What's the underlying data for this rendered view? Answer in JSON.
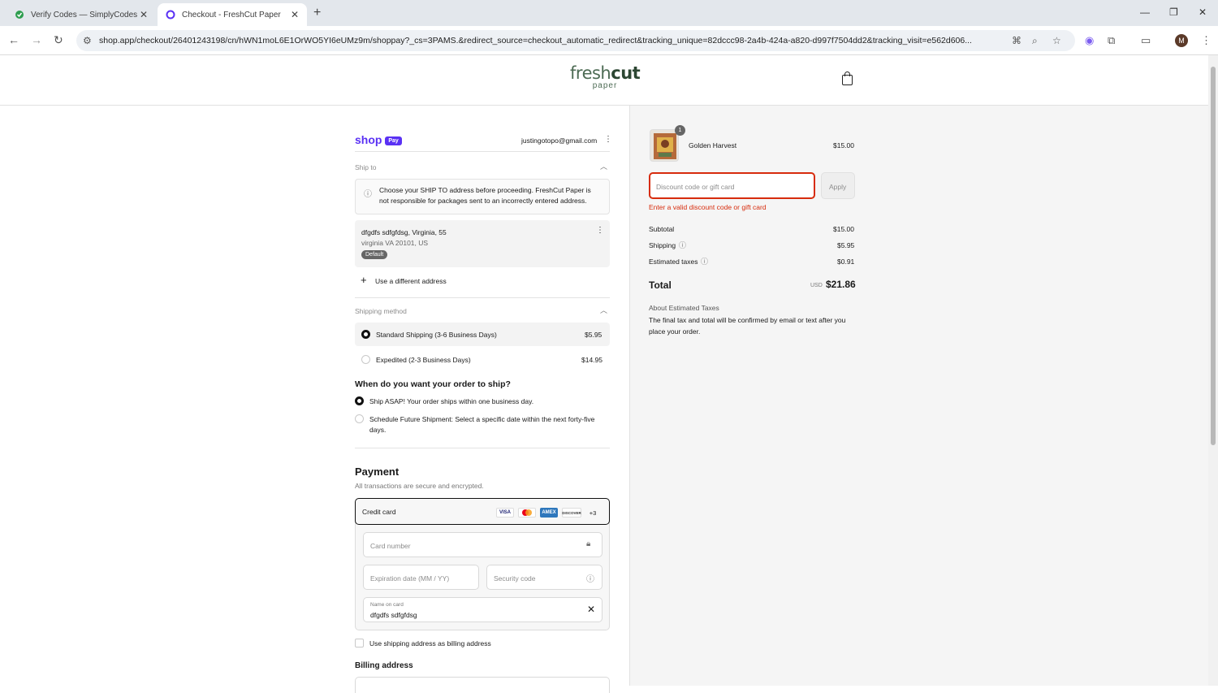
{
  "browser": {
    "tabs": [
      {
        "title": "Verify Codes — SimplyCodes"
      },
      {
        "title": "Checkout - FreshCut Paper"
      }
    ],
    "url": "shop.app/checkout/26401243198/cn/hWN1moL6E1OrWO5YI6eUMz9m/shoppay?_cs=3PAMS.&redirect_source=checkout_automatic_redirect&tracking_unique=82dccc98-2a4b-424a-a820-d997f7504dd2&tracking_visit=e562d606...",
    "profile_initial": "M"
  },
  "store": {
    "logo_line1": "fresh",
    "logo_line1_bold": "cut",
    "logo_line2": "paper"
  },
  "shoppay": {
    "brand": "shop",
    "badge": "Pay",
    "email": "justingotopo@gmail.com"
  },
  "ship_to": {
    "section_label": "Ship to",
    "notice": "Choose your SHIP TO address before proceeding. FreshCut Paper is not responsible for packages sent to an incorrectly entered address.",
    "address_line1": "dfgdfs sdfgfdsg, Virginia, 55",
    "address_line2": "virginia VA 20101, US",
    "default_badge": "Default",
    "use_different": "Use a different address"
  },
  "shipping_method": {
    "section_label": "Shipping method",
    "options": [
      {
        "label": "Standard Shipping (3-6 Business Days)",
        "price": "$5.95",
        "selected": true
      },
      {
        "label": "Expedited (2-3 Business Days)",
        "price": "$14.95",
        "selected": false
      }
    ]
  },
  "ship_when": {
    "question": "When do you want your order to ship?",
    "options": [
      {
        "label": "Ship ASAP! Your order ships within one business day.",
        "selected": true
      },
      {
        "label_line1": "Schedule Future Shipment: Select a specific date within the next forty-five",
        "label_line2": "days.",
        "selected": false
      }
    ]
  },
  "payment": {
    "title": "Payment",
    "subtitle": "All transactions are secure and encrypted.",
    "method": "Credit card",
    "card_brands": [
      "VISA",
      "MC",
      "AMEX",
      "DISCOVER"
    ],
    "more_brands": "+3",
    "card_number_placeholder": "Card number",
    "expiry_placeholder": "Expiration date (MM / YY)",
    "security_placeholder": "Security code",
    "name_label": "Name on card",
    "name_value": "dfgdfs sdfgfdsg",
    "billing_checkbox": "Use shipping address as billing address",
    "billing_title": "Billing address"
  },
  "summary": {
    "item_name": "Golden Harvest",
    "item_qty": "1",
    "item_price": "$15.00",
    "discount_placeholder": "Discount code or gift card",
    "apply_label": "Apply",
    "discount_error": "Enter a valid discount code or gift card",
    "subtotal_label": "Subtotal",
    "subtotal_value": "$15.00",
    "shipping_label": "Shipping",
    "shipping_value": "$5.95",
    "taxes_label": "Estimated taxes",
    "taxes_value": "$0.91",
    "total_label": "Total",
    "currency": "USD",
    "total_value": "$21.86",
    "about_taxes_title": "About Estimated Taxes",
    "about_taxes_text": "The final tax and total will be confirmed by email or text after you place your order."
  },
  "colors": {
    "error": "#d72c0d",
    "shoppay": "#5a31f4",
    "accent": "#111111"
  }
}
